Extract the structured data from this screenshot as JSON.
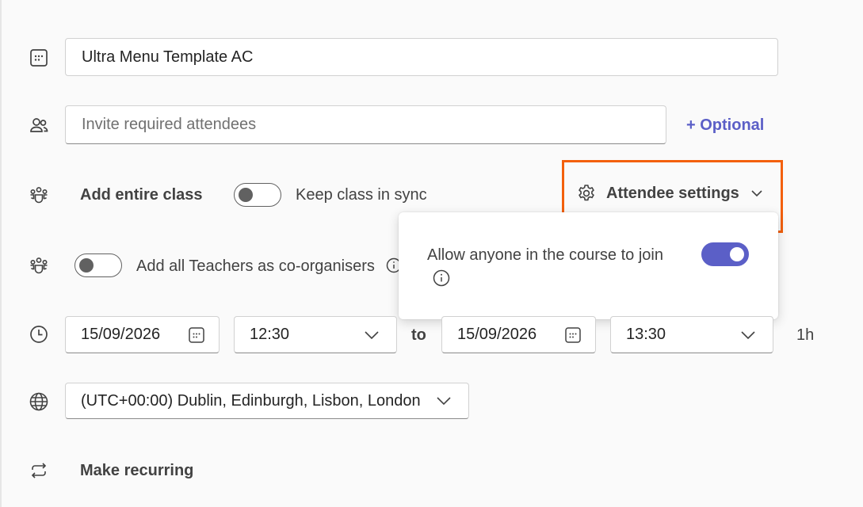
{
  "title_field": {
    "value": "Ultra Menu Template AC"
  },
  "attendees": {
    "placeholder": "Invite required attendees",
    "optional_label": "+ Optional"
  },
  "class_row": {
    "label": "Add entire class",
    "sync_label": "Keep class in sync",
    "toggle_on": false
  },
  "attendee_settings": {
    "label": "Attendee settings"
  },
  "teachers_row": {
    "label": "Add all Teachers as co-organisers",
    "toggle_on": false
  },
  "popover": {
    "label": "Allow anyone in the course to join",
    "toggle_on": true
  },
  "time_row": {
    "start_date": "15/09/2026",
    "start_time": "12:30",
    "to_label": "to",
    "end_date": "15/09/2026",
    "end_time": "13:30",
    "duration": "1h"
  },
  "timezone": {
    "value": "(UTC+00:00) Dublin, Edinburgh, Lisbon, London"
  },
  "recurring": {
    "label": "Make recurring"
  },
  "colors": {
    "accent": "#5b5fc7",
    "highlight": "#f3600c",
    "text": "#242424",
    "muted": "#424242"
  },
  "icons": [
    "title-icon",
    "people-icon",
    "class-icon",
    "teachers-icon",
    "clock-icon",
    "calendar-icon",
    "chevron-down-icon",
    "gear-icon",
    "info-icon",
    "globe-icon",
    "repeat-icon"
  ]
}
